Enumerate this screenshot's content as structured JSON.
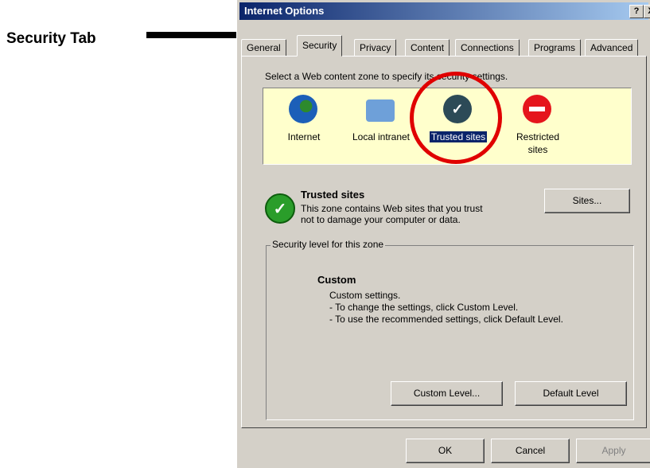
{
  "annotation": {
    "label": "Security Tab"
  },
  "window": {
    "title": "Internet Options",
    "help_button": "?",
    "close_button": "X"
  },
  "tabs": [
    {
      "label": "General",
      "active": false
    },
    {
      "label": "Security",
      "active": true
    },
    {
      "label": "Privacy",
      "active": false
    },
    {
      "label": "Content",
      "active": false
    },
    {
      "label": "Connections",
      "active": false
    },
    {
      "label": "Programs",
      "active": false
    },
    {
      "label": "Advanced",
      "active": false
    }
  ],
  "zone_prompt": "Select a Web content zone to specify its security settings.",
  "zones": [
    {
      "label": "Internet",
      "icon": "globe-icon"
    },
    {
      "label": "Local intranet",
      "icon": "monitor-icon"
    },
    {
      "label": "Trusted sites",
      "icon": "check-icon",
      "selected": true
    },
    {
      "label": "Restricted sites",
      "icon": "restricted-icon"
    }
  ],
  "selected_zone": {
    "title": "Trusted sites",
    "description": "This zone contains Web sites that you trust not to damage your computer or data.",
    "sites_button": "Sites..."
  },
  "security_level": {
    "group_label": "Security level for this zone",
    "level_name": "Custom",
    "description": "Custom settings.\n- To change the settings, click Custom Level.\n- To use the recommended settings, click Default Level.",
    "custom_level_button": "Custom Level...",
    "default_level_button": "Default Level"
  },
  "footer": {
    "ok": "OK",
    "cancel": "Cancel",
    "apply": "Apply"
  },
  "colors": {
    "title_bar": "#0a246a",
    "zone_background": "#ffffcc",
    "highlight_circle": "#e00000",
    "dialog_face": "#d4d0c8"
  }
}
